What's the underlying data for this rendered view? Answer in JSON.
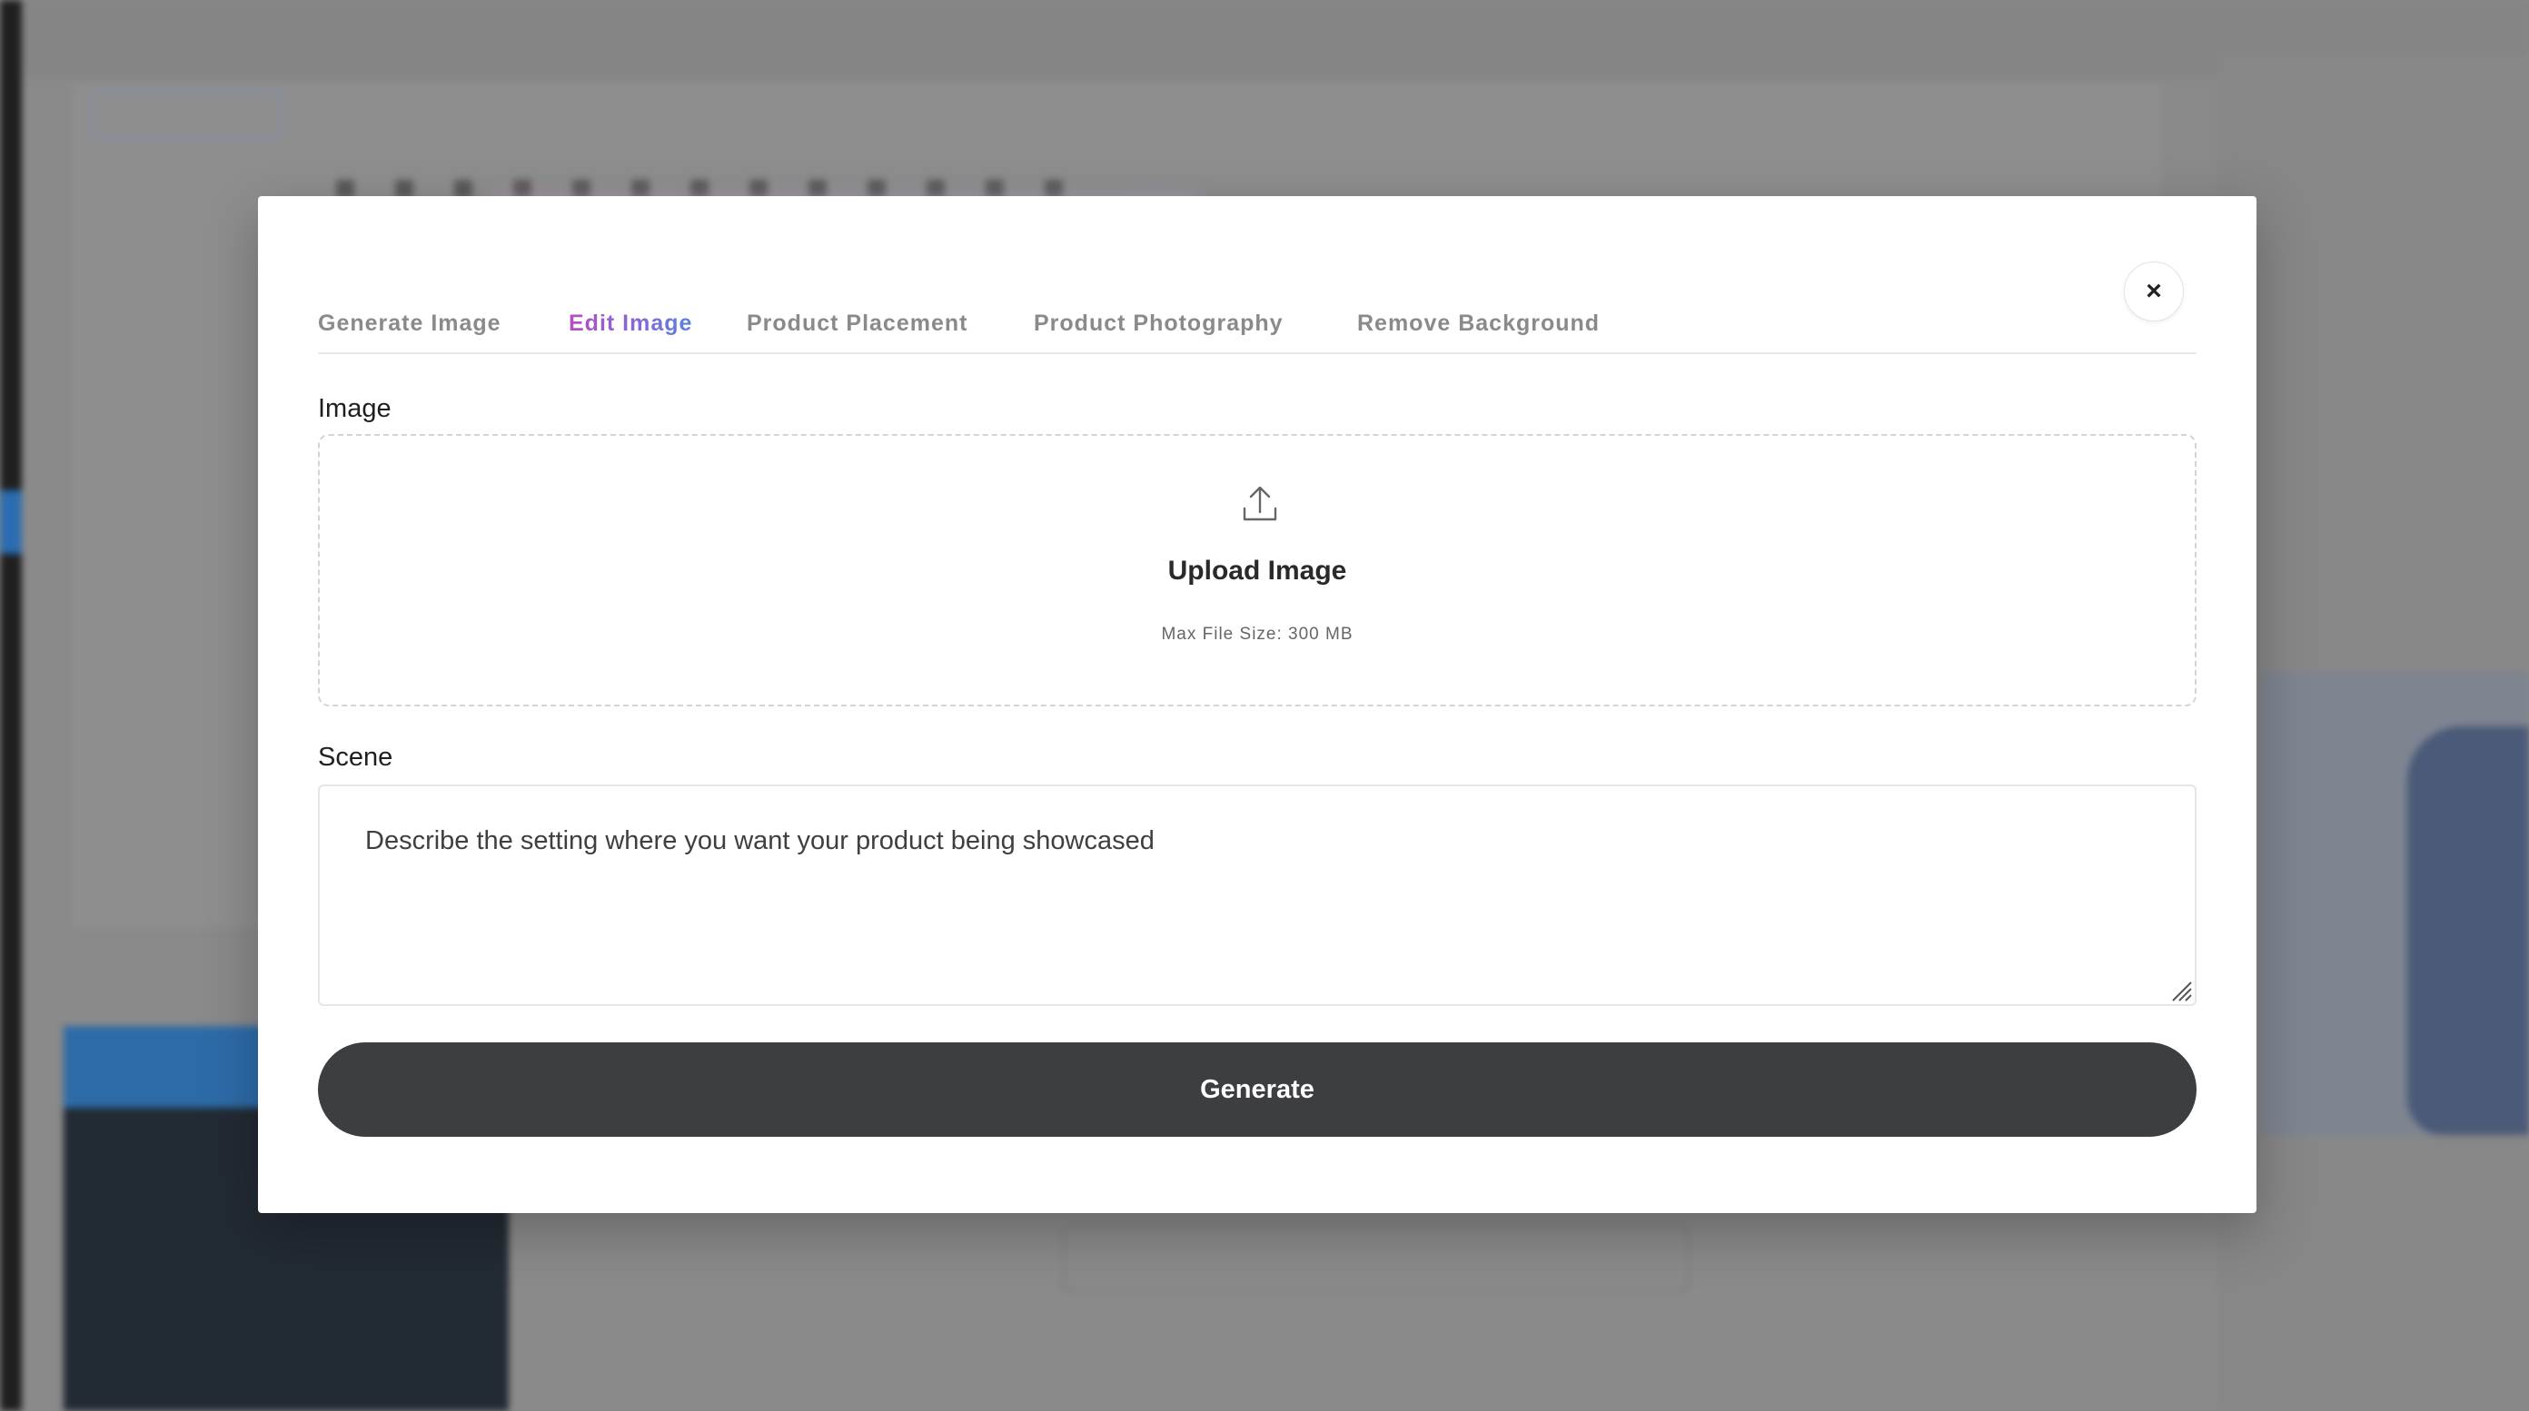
{
  "modal": {
    "tabs": [
      {
        "label": "Generate Image",
        "active": false
      },
      {
        "label": "Edit Image",
        "active": true
      },
      {
        "label": "Product Placement",
        "active": false
      },
      {
        "label": "Product Photography",
        "active": false
      },
      {
        "label": "Remove Background",
        "active": false
      }
    ],
    "close_label": "×",
    "image_label": "Image",
    "upload": {
      "icon": "upload-icon",
      "title": "Upload Image",
      "subtitle": "Max File Size: 300 MB"
    },
    "scene_label": "Scene",
    "scene_placeholder": "Describe the setting where you want your product being showcased",
    "generate_label": "Generate"
  },
  "colors": {
    "accent_gradient_start": "#b54fc0",
    "accent_gradient_end": "#5b7fe0",
    "generate_button": "#3d3e42"
  }
}
